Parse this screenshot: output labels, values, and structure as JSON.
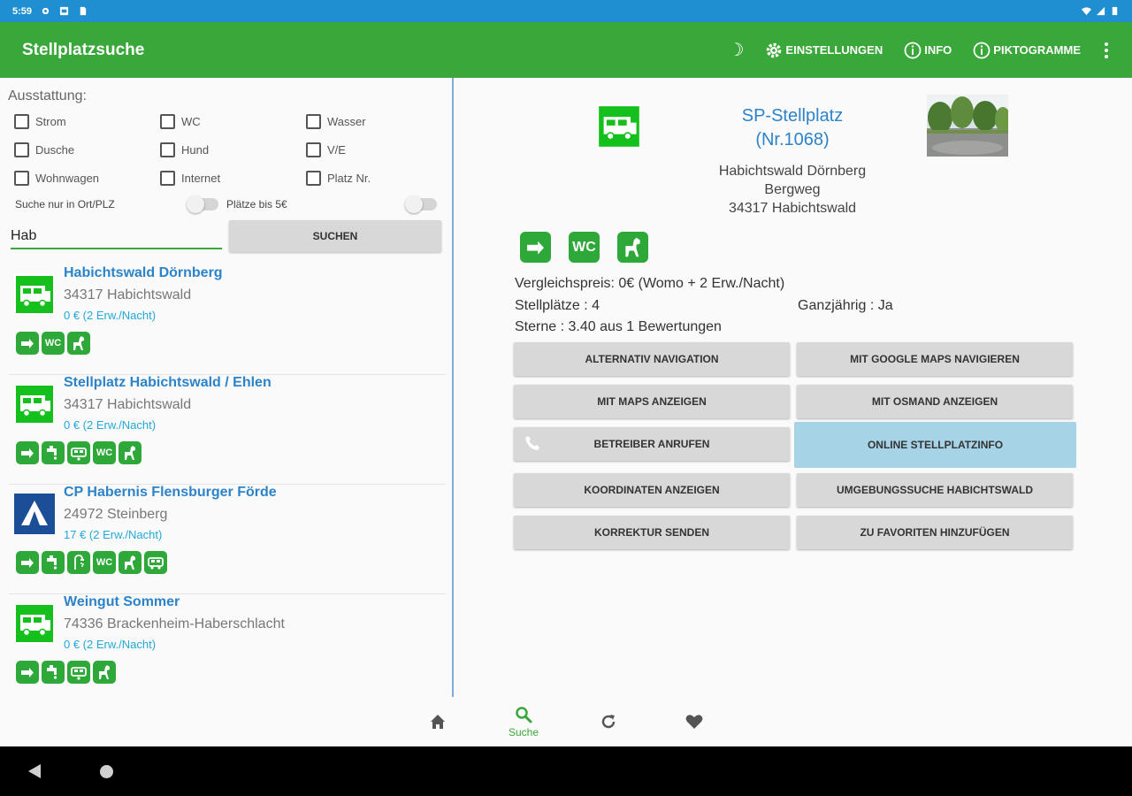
{
  "status_bar": {
    "time": "5:59"
  },
  "app_bar": {
    "title": "Stellplatzsuche",
    "actions": {
      "einstellungen": "EINSTELLUNGEN",
      "info": "INFO",
      "piktogramme": "PIKTOGRAMME"
    }
  },
  "filters": {
    "heading": "Ausstattung:",
    "checkboxes": [
      "Strom",
      "WC",
      "Wasser",
      "Dusche",
      "Hund",
      "V/E",
      "Wohnwagen",
      "Internet",
      "Platz Nr."
    ],
    "toggle_ort": "Suche nur in Ort/PLZ",
    "toggle_price": "Plätze bis 5€"
  },
  "search": {
    "value": "Hab",
    "button": "SUCHEN"
  },
  "results": [
    {
      "name": "Habichtswald Dörnberg",
      "city": "34317 Habichtswald",
      "price": "0 € (2 Erw./Nacht)",
      "type": "stellplatz",
      "icons": [
        "strom",
        "wc",
        "hund"
      ]
    },
    {
      "name": "Stellplatz Habichtswald / Ehlen",
      "city": "34317 Habichtswald",
      "price": "0 € (2 Erw./Nacht)",
      "type": "stellplatz",
      "icons": [
        "strom",
        "wasser",
        "entsorgung",
        "wc",
        "hund"
      ]
    },
    {
      "name": "CP Habernis Flensburger Förde",
      "city": "24972 Steinberg",
      "price": "17 € (2 Erw./Nacht)",
      "type": "campingplatz",
      "icons": [
        "strom",
        "wasser",
        "dusche",
        "wc",
        "hund",
        "wohnmobil"
      ]
    },
    {
      "name": "Weingut Sommer",
      "city": "74336 Brackenheim-Haberschlacht",
      "price": "0 € (2 Erw./Nacht)",
      "type": "stellplatz",
      "icons": [
        "strom",
        "wasser",
        "entsorgung",
        "hund"
      ]
    }
  ],
  "detail": {
    "title": "SP-Stellplatz",
    "number": "(Nr.1068)",
    "address": [
      "Habichtswald Dörnberg",
      "Bergweg",
      "34317 Habichtswald"
    ],
    "vergleichspreis": "Vergleichspreis: 0€ (Womo + 2 Erw./Nacht)",
    "stellplaetze": "Stellplätze : 4",
    "ganzjaehrig": "Ganzjährig : Ja",
    "sterne": "Sterne : 3.40 aus 1 Bewertungen",
    "icon_wc": "WC",
    "buttons": {
      "alternativ": "ALTERNATIV NAVIGATION",
      "google": "MIT GOOGLE MAPS NAVIGIEREN",
      "maps": "MIT MAPS ANZEIGEN",
      "osmand": "MIT OSMAND ANZEIGEN",
      "anrufen": "BETREIBER ANRUFEN",
      "online": "ONLINE STELLPLATZINFO",
      "koordinaten": "KOORDINATEN ANZEIGEN",
      "umgebung": "UMGEBUNGSSUCHE HABICHTSWALD",
      "korrektur": "KORREKTUR SENDEN",
      "favoriten": "ZU FAVORITEN HINZUFÜGEN"
    }
  },
  "bottom_nav": {
    "suche": "Suche"
  },
  "colors": {
    "primary": "#3aa73a",
    "status": "#1f8fd1",
    "link": "#2c83c9",
    "price": "#23a8d8",
    "active_button": "#a6d3e6"
  }
}
